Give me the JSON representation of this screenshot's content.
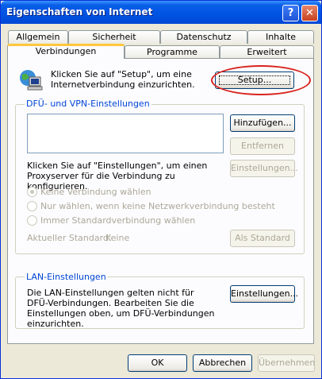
{
  "window": {
    "title": "Eigenschaften von Internet",
    "help": "?",
    "close": "✕"
  },
  "tabs_row1": [
    "Allgemein",
    "Sicherheit",
    "Datenschutz",
    "Inhalte"
  ],
  "tabs_row2": [
    "Verbindungen",
    "Programme",
    "Erweitert"
  ],
  "setup": {
    "text": "Klicken Sie auf \"Setup\", um eine Internetverbindung einzurichten.",
    "button": "Setup..."
  },
  "dialup": {
    "label": "DFÜ- und VPN-Einstellungen",
    "add": "Hinzufügen...",
    "remove": "Entfernen",
    "settings_text": "Klicken Sie auf \"Einstellungen\", um einen Proxyserver für die Verbindung zu konfigurieren.",
    "settings": "Einstellungen...",
    "radios": [
      "Keine Verbindung wählen",
      "Nur wählen, wenn keine Netzwerkverbindung besteht",
      "Immer Standardverbindung wählen"
    ],
    "default_label": "Aktueller Standard:",
    "default_value": "Keine",
    "set_default": "Als Standard"
  },
  "lan": {
    "label": "LAN-Einstellungen",
    "text": "Die LAN-Einstellungen gelten nicht für DFÜ-Verbindungen. Bearbeiten Sie die Einstellungen oben, um DFÜ-Verbindungen einzurichten.",
    "settings": "Einstellungen..."
  },
  "footer": {
    "ok": "OK",
    "cancel": "Abbrechen",
    "apply": "Übernehmen"
  }
}
